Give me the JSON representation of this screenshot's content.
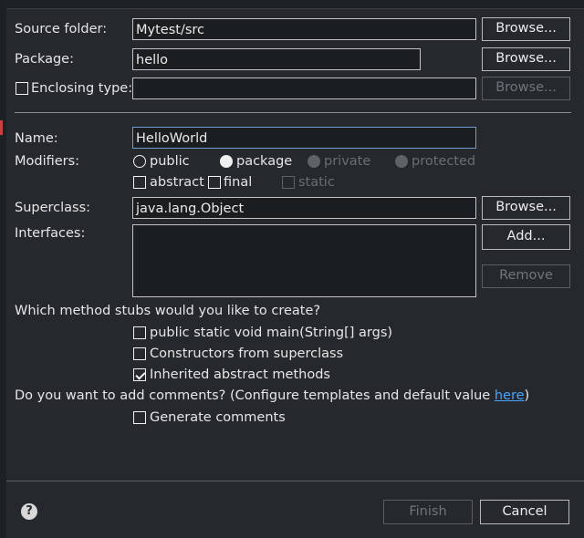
{
  "source_folder": {
    "label": "Source folder:",
    "value": "Mytest/src",
    "browse": "Browse..."
  },
  "package": {
    "label": "Package:",
    "value": "hello",
    "browse": "Browse..."
  },
  "enclosing": {
    "label": "Enclosing type:",
    "value": "",
    "browse": "Browse..."
  },
  "name": {
    "label": "Name:",
    "value": "HelloWorld"
  },
  "modifiers": {
    "label": "Modifiers:",
    "public": "public",
    "package": "package",
    "private": "private",
    "protected": "protected",
    "abstract": "abstract",
    "final": "final",
    "static": "static"
  },
  "superclass": {
    "label": "Superclass:",
    "value": "java.lang.Object",
    "browse": "Browse..."
  },
  "interfaces": {
    "label": "Interfaces:",
    "add": "Add...",
    "remove": "Remove"
  },
  "stubs": {
    "question": "Which method stubs would you like to create?",
    "main": "public static void main(String[] args)",
    "constructors": "Constructors from superclass",
    "inherited": "Inherited abstract methods"
  },
  "comments": {
    "question_prefix": "Do you want to add comments? (Configure templates and default value ",
    "link": "here",
    "question_suffix": ")",
    "generate": "Generate comments"
  },
  "footer": {
    "help": "?",
    "finish": "Finish",
    "cancel": "Cancel"
  }
}
